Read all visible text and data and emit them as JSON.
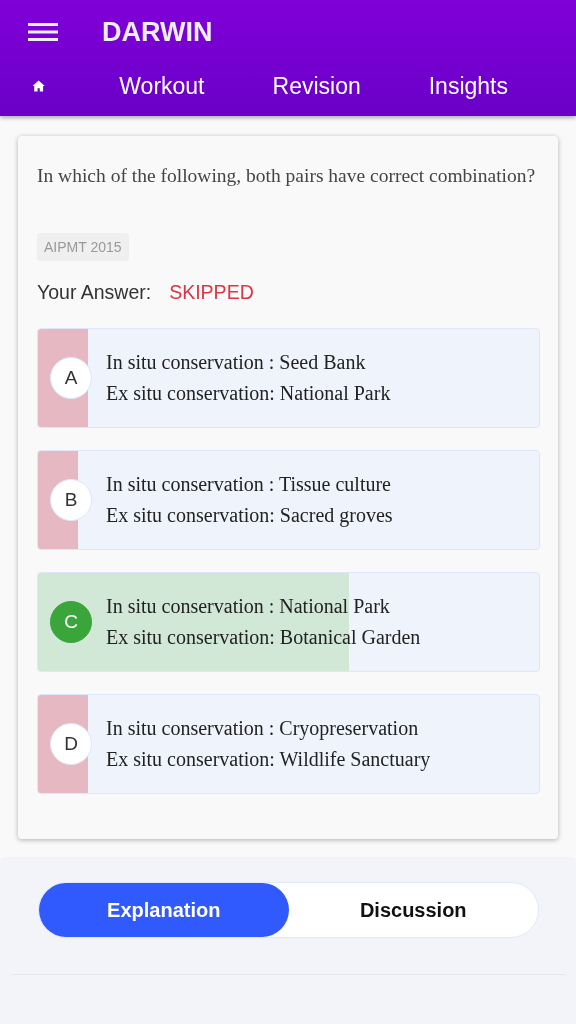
{
  "app_bar": {
    "title": "DARWIN"
  },
  "nav_tabs": [
    {
      "kind": "home"
    },
    {
      "kind": "text",
      "label": "Workout"
    },
    {
      "kind": "text",
      "label": "Revision"
    },
    {
      "kind": "text",
      "label": "Insights"
    }
  ],
  "question": {
    "text": "In which of the following, both pairs have correct combination?",
    "tag": "AIPMT 2015",
    "answer_label": "Your Answer:",
    "answer_value": "SKIPPED"
  },
  "options": [
    {
      "letter": "A",
      "line_1": "In situ conservation : Seed Bank",
      "line_2": "Ex situ conservation: National Park",
      "correct": false,
      "level": 0.1
    },
    {
      "letter": "B",
      "line_1": "In situ conservation : Tissue culture",
      "line_2": "Ex situ conservation: Sacred groves",
      "correct": false,
      "level": 0.08
    },
    {
      "letter": "C",
      "line_1": "In situ conservation : National Park",
      "line_2": "Ex situ conservation: Botanical Garden",
      "correct": true,
      "level": 0.62
    },
    {
      "letter": "D",
      "line_1": "In situ conservation : Cryopreservation",
      "line_2": "Ex situ conservation: Wildlife Sanctuary",
      "correct": false,
      "level": 0.1
    }
  ],
  "segments": [
    {
      "label": "Explanation",
      "selected": true
    },
    {
      "label": "Discussion",
      "selected": false
    }
  ]
}
